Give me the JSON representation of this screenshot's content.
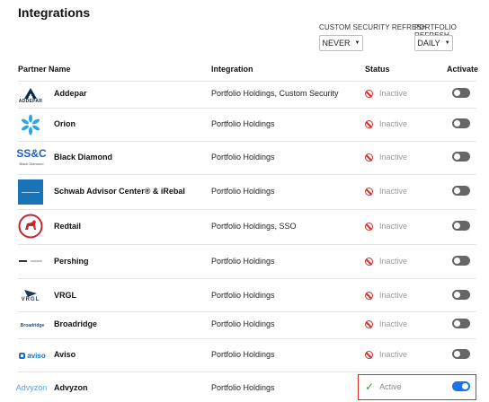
{
  "page": {
    "title": "Integrations"
  },
  "filters": {
    "security_refresh": {
      "label": "CUSTOM SECURITY REFRESH",
      "value": "NEVER"
    },
    "portfolio_refresh": {
      "label": "PORTFOLIO REFRESH",
      "value": "DAILY"
    }
  },
  "table": {
    "headers": {
      "partner": "Partner Name",
      "integration": "Integration",
      "status": "Status",
      "activate": "Activate"
    },
    "rows": [
      {
        "name": "Addepar",
        "integration": "Portfolio Holdings, Custom Security",
        "status": "Inactive",
        "active": false,
        "logo": "addepar-logo",
        "logo_text": "ADDEPAR"
      },
      {
        "name": "Orion",
        "integration": "Portfolio Holdings",
        "status": "Inactive",
        "active": false,
        "logo": "orion-logo"
      },
      {
        "name": "Black Diamond",
        "integration": "Portfolio Holdings",
        "status": "Inactive",
        "active": false,
        "logo": "ssc-logo",
        "logo_text": "SS&C",
        "logo_sub": "Black Diamond"
      },
      {
        "name": "Schwab Advisor Center® & iRebal",
        "integration": "Portfolio Holdings",
        "status": "Inactive",
        "active": false,
        "logo": "schwab-logo"
      },
      {
        "name": "Redtail",
        "integration": "Portfolio Holdings, SSO",
        "status": "Inactive",
        "active": false,
        "logo": "redtail-logo"
      },
      {
        "name": "Pershing",
        "integration": "Portfolio Holdings",
        "status": "Inactive",
        "active": false,
        "logo": "pershing-logo"
      },
      {
        "name": "VRGL",
        "integration": "Portfolio Holdings",
        "status": "Inactive",
        "active": false,
        "logo": "vrgl-logo",
        "logo_text": "VRGL"
      },
      {
        "name": "Broadridge",
        "integration": "Portfolio Holdings",
        "status": "Inactive",
        "active": false,
        "logo": "broadridge-logo",
        "logo_text": "Broadridge"
      },
      {
        "name": "Aviso",
        "integration": "Portfolio Holdings",
        "status": "Inactive",
        "active": false,
        "logo": "aviso-logo",
        "logo_text": "aviso"
      },
      {
        "name": "Advyzon",
        "integration": "Portfolio Holdings",
        "status": "Active",
        "active": true,
        "logo": "advyzon-logo",
        "logo_text": "Advyzon"
      }
    ]
  },
  "colors": {
    "accent": "#1a73e8",
    "inactive": "#d32f2f",
    "active": "#2e9e3f",
    "highlight": "#d93025"
  }
}
